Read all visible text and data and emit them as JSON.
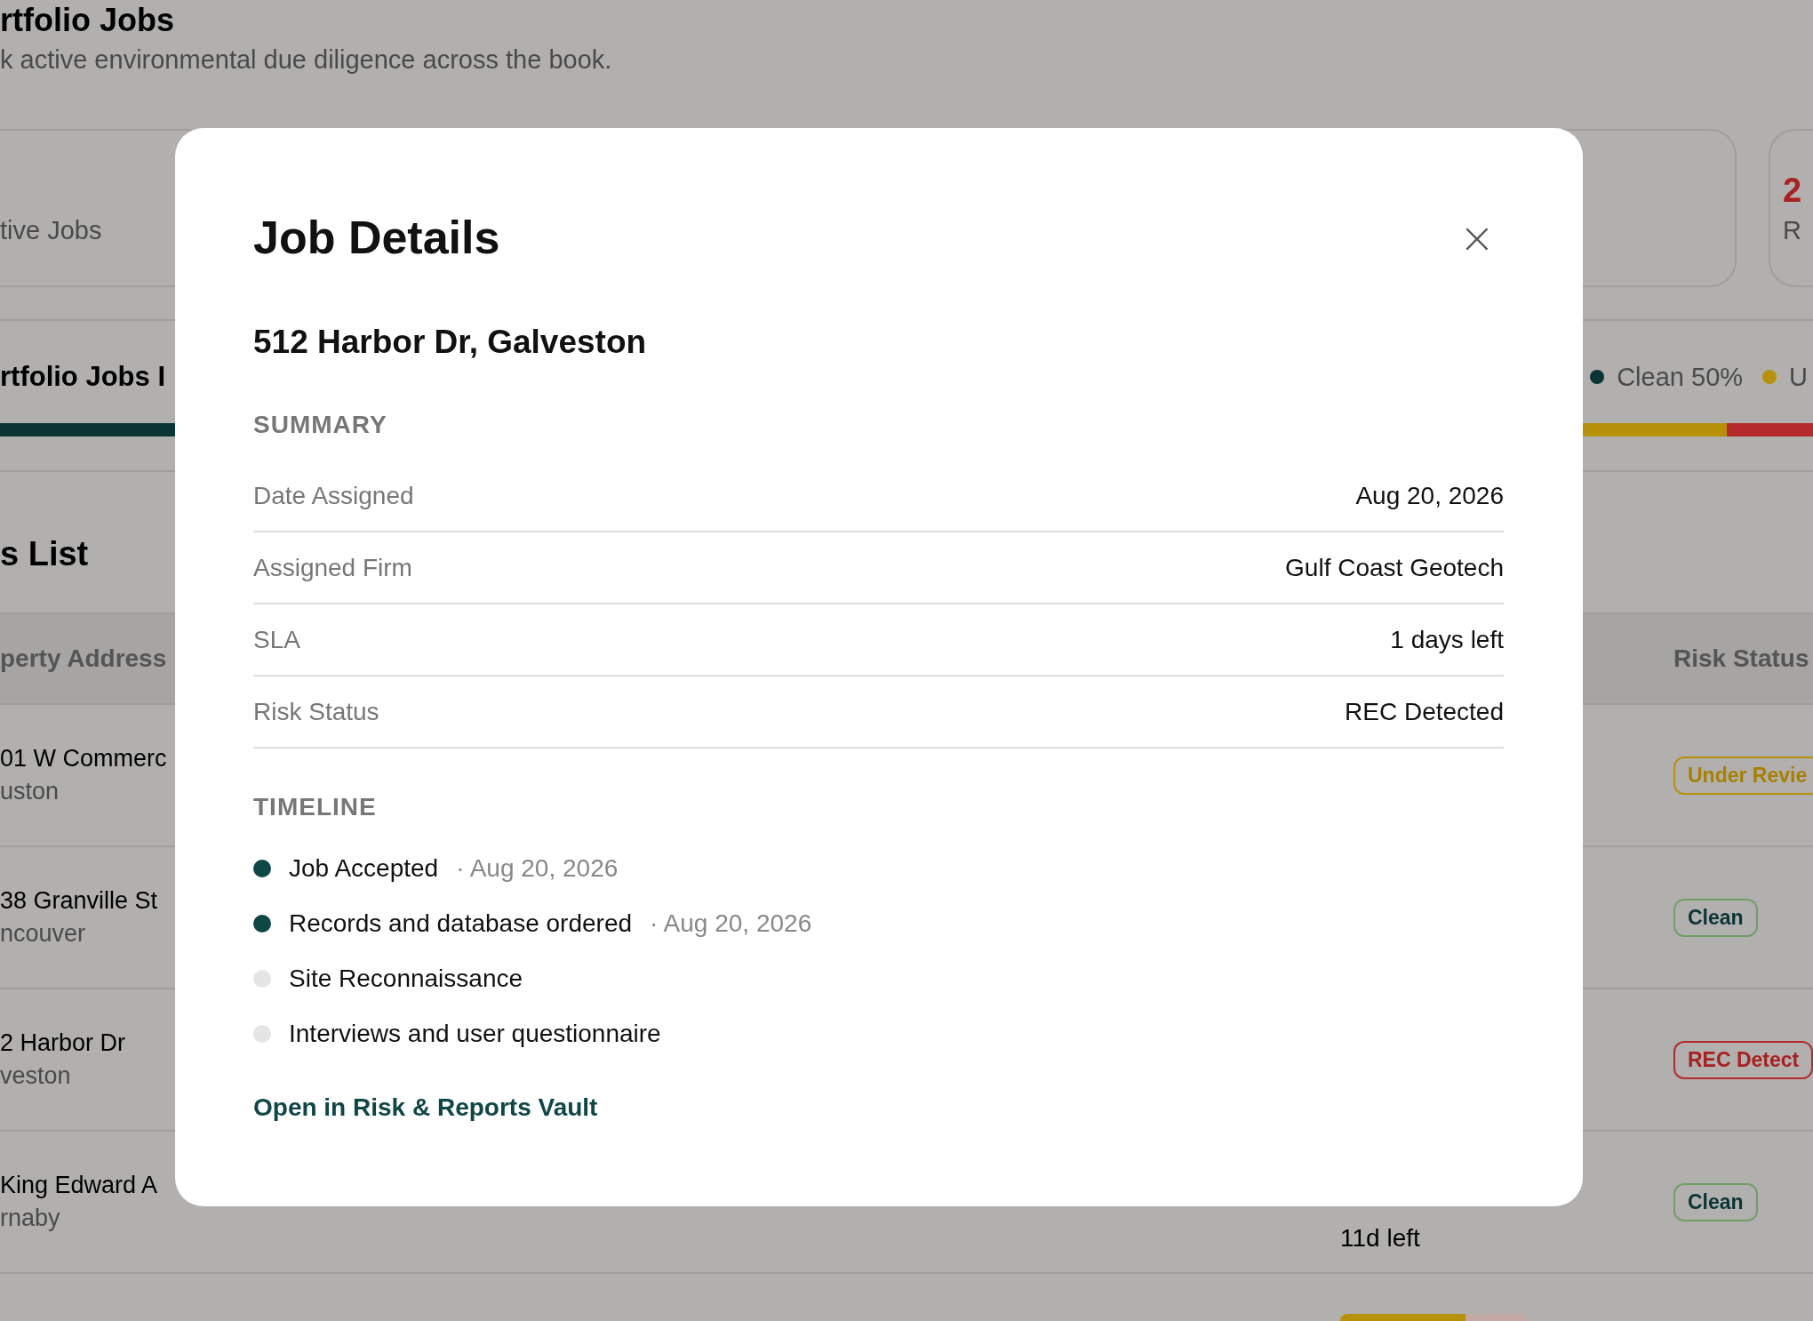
{
  "page": {
    "title": "rtfolio Jobs",
    "subtitle": "k active environmental due diligence across the book."
  },
  "stat_cards": [
    {
      "label": "tive Jobs"
    },
    {
      "value": "2",
      "label": "R"
    }
  ],
  "breakdown": {
    "title": "rtfolio Jobs I",
    "legend": [
      {
        "label": "Clean 50%",
        "color": "#0b3535"
      },
      {
        "label": "U",
        "color": "#b8910a"
      }
    ]
  },
  "jobs_list": {
    "title": "s List",
    "columns": [
      "perty Address",
      "Risk Status"
    ],
    "rows": [
      {
        "address": "01 W Commerc",
        "city": "uston",
        "status": {
          "label": "Under Revie",
          "kind": "review"
        }
      },
      {
        "address": "38 Granville St",
        "city": "ncouver",
        "status": {
          "label": "Clean",
          "kind": "clean"
        }
      },
      {
        "address": "2 Harbor Dr",
        "city": "veston",
        "status": {
          "label": "REC Detect",
          "kind": "rec"
        }
      },
      {
        "address": "King Edward A",
        "city": "rnaby",
        "sla": "11d left",
        "status": {
          "label": "Clean",
          "kind": "clean"
        }
      },
      {
        "level": 0.67
      }
    ]
  },
  "modal": {
    "title": "Job Details",
    "close": "×",
    "property": "512 Harbor Dr, Galveston",
    "summary_heading": "SUMMARY",
    "summary": [
      {
        "label": "Date Assigned",
        "value": "Aug 20, 2026"
      },
      {
        "label": "Assigned Firm",
        "value": "Gulf Coast Geotech"
      },
      {
        "label": "SLA",
        "value": "1 days left"
      },
      {
        "label": "Risk Status",
        "value": "REC Detected"
      }
    ],
    "timeline_heading": "TIMELINE",
    "timeline": [
      {
        "label": "Job Accepted",
        "date": "· Aug 20, 2026",
        "done": true
      },
      {
        "label": "Records and database ordered",
        "date": "· Aug 20, 2026",
        "done": true
      },
      {
        "label": "Site Reconnaissance",
        "done": false
      },
      {
        "label": "Interviews and user questionnaire",
        "done": false
      }
    ],
    "link": "Open in Risk & Reports Vault"
  }
}
